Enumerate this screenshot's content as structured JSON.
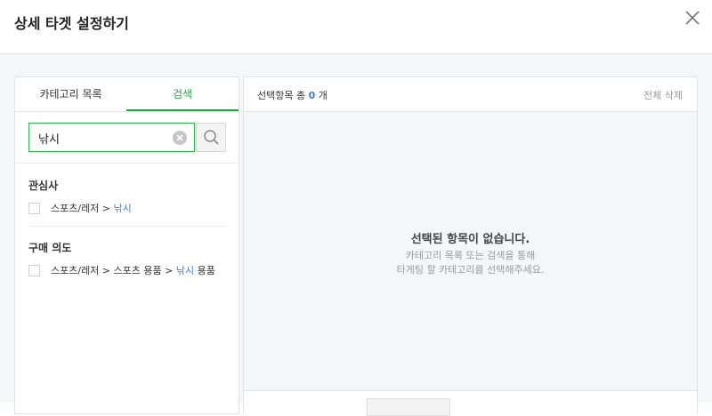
{
  "header": {
    "title": "상세 타겟 설정하기"
  },
  "left": {
    "tabs": [
      {
        "label": "카테고리 목록"
      },
      {
        "label": "검색"
      }
    ],
    "search": {
      "value": "낚시"
    },
    "groups": [
      {
        "label": "관심사",
        "items": [
          {
            "prefix": "스포츠/레저 > ",
            "highlight": "낚시",
            "suffix": ""
          }
        ]
      },
      {
        "label": "구매 의도",
        "items": [
          {
            "prefix": "스포츠/레저 > 스포츠 용품 > ",
            "highlight": "낚시",
            "suffix": " 용품"
          }
        ]
      }
    ]
  },
  "right": {
    "count_label": "선택항목 총",
    "count": "0",
    "count_unit": "개",
    "delete_all": "전체 삭제",
    "empty_title": "선택된 항목이 없습니다.",
    "empty_desc_1": "카테고리 목록 또는 검색을 통해",
    "empty_desc_2": "타게팅 할 카테고리를 선택해주세요."
  }
}
